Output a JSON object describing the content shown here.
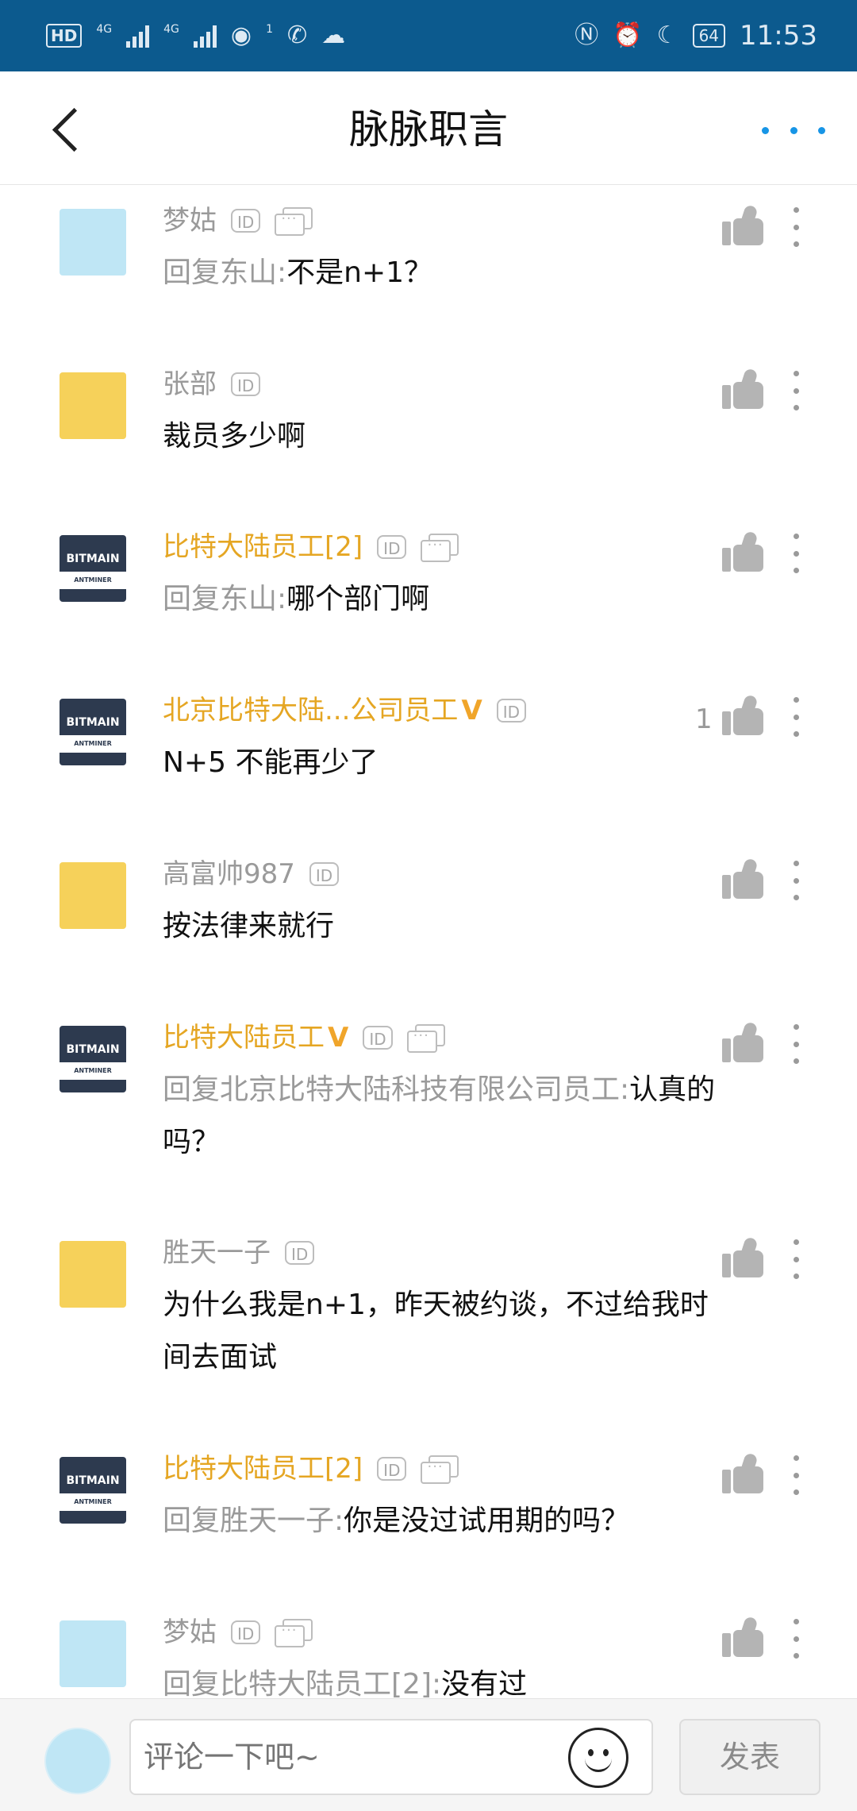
{
  "status_bar": {
    "hd": "HD",
    "net1": "4G",
    "net2": "4G",
    "hotspot_count": "1",
    "battery": "64",
    "time": "11:53",
    "icons": [
      "signal-icon",
      "hotspot-icon",
      "missed-call-icon",
      "wechat-icon",
      "nfc-icon",
      "alarm-icon",
      "moon-icon",
      "battery-icon"
    ]
  },
  "header": {
    "title": "脉脉职言",
    "back_icon": "back-chevron-icon",
    "more_icon": "more-dots-icon"
  },
  "comments": [
    {
      "name": "梦姑",
      "name_style": "gray",
      "verified": false,
      "has_msg_icon": true,
      "avatar": "sheep",
      "prefix": "回复东山:",
      "text": "不是n+1？",
      "likes": ""
    },
    {
      "name": "张部",
      "name_style": "gray",
      "verified": false,
      "has_msg_icon": false,
      "avatar": "monkey",
      "prefix": "",
      "text": "裁员多少啊",
      "likes": ""
    },
    {
      "name": "比特大陆员工[2]",
      "name_style": "gold",
      "verified": false,
      "has_msg_icon": true,
      "avatar": "bitmain",
      "prefix": "回复东山:",
      "text": "哪个部门啊",
      "likes": ""
    },
    {
      "name": "北京比特大陆...公司员工",
      "name_style": "gold",
      "verified": true,
      "has_msg_icon": false,
      "avatar": "bitmain",
      "prefix": "",
      "text": "N+5 不能再少了",
      "likes": "1"
    },
    {
      "name": "高富帅987",
      "name_style": "gray",
      "verified": false,
      "has_msg_icon": false,
      "avatar": "monkey",
      "prefix": "",
      "text": "按法律来就行",
      "likes": ""
    },
    {
      "name": "比特大陆员工",
      "name_style": "gold",
      "verified": true,
      "has_msg_icon": true,
      "avatar": "bitmain",
      "prefix": "回复北京比特大陆科技有限公司员工:",
      "text": "认真的吗？",
      "likes": ""
    },
    {
      "name": "胜天一子",
      "name_style": "gray",
      "verified": false,
      "has_msg_icon": false,
      "avatar": "monkey",
      "prefix": "",
      "text": "为什么我是n+1，昨天被约谈，不过给我时间去面试",
      "likes": ""
    },
    {
      "name": "比特大陆员工[2]",
      "name_style": "gold",
      "verified": false,
      "has_msg_icon": true,
      "avatar": "bitmain",
      "prefix": "回复胜天一子:",
      "text": "你是没过试用期的吗？",
      "likes": ""
    },
    {
      "name": "梦姑",
      "name_style": "gray",
      "verified": false,
      "has_msg_icon": true,
      "avatar": "sheep",
      "prefix": "回复比特大陆员工[2]:",
      "text": "没有过",
      "likes": ""
    }
  ],
  "badges": {
    "id_label": "ID",
    "verified_label": "V"
  },
  "avatar_text": {
    "bitmain_top": "BITMAIN",
    "bitmain_bottom": "ANTMINER"
  },
  "bottom_bar": {
    "placeholder": "评论一下吧~",
    "send_label": "发表",
    "emoji_icon": "smiley-icon"
  },
  "colors": {
    "status_bar": "#0c5a8e",
    "accent_blue": "#1795e6",
    "gold_name": "#e5a623",
    "gray_text": "#9a9a9a"
  }
}
